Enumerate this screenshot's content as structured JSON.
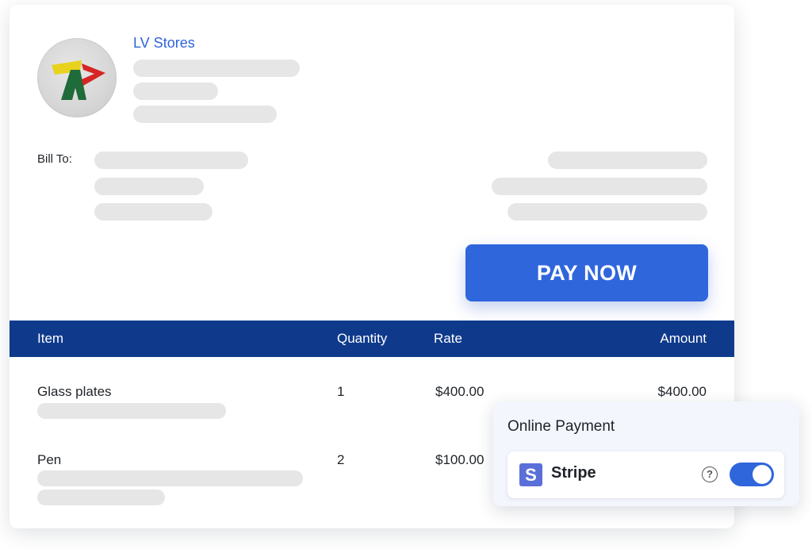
{
  "store": {
    "name": "LV Stores"
  },
  "bill_to": {
    "label": "Bill To:"
  },
  "actions": {
    "pay_now_label": "PAY NOW"
  },
  "table": {
    "headers": [
      "Item",
      "Quantity",
      "Rate",
      "Amount"
    ],
    "rows": [
      {
        "item": "Glass plates",
        "quantity": "1",
        "rate": "$400.00",
        "amount": "$400.00"
      },
      {
        "item": "Pen",
        "quantity": "2",
        "rate": "$100.00",
        "amount": ""
      }
    ]
  },
  "online_payment": {
    "title": "Online Payment",
    "provider": "Stripe",
    "provider_icon": "stripe-logo-icon",
    "enabled": true
  },
  "colors": {
    "accent": "#2f66dc",
    "table_header": "#0f3a8c",
    "store_name": "#2f64d6"
  }
}
